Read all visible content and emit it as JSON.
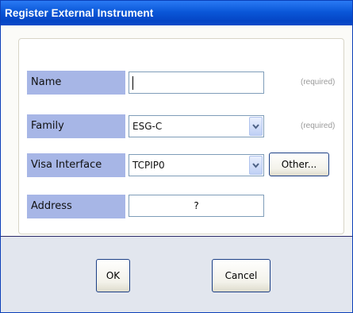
{
  "window": {
    "title": "Register External Instrument"
  },
  "form": {
    "name": {
      "label": "Name",
      "value": "",
      "hint": "(required)"
    },
    "family": {
      "label": "Family",
      "selected": "ESG-C",
      "hint": "(required)"
    },
    "visa_interface": {
      "label": "Visa Interface",
      "selected": "TCPIP0",
      "other_button": "Other..."
    },
    "address": {
      "label": "Address",
      "value": "?"
    }
  },
  "buttons": {
    "ok": "OK",
    "cancel": "Cancel"
  }
}
